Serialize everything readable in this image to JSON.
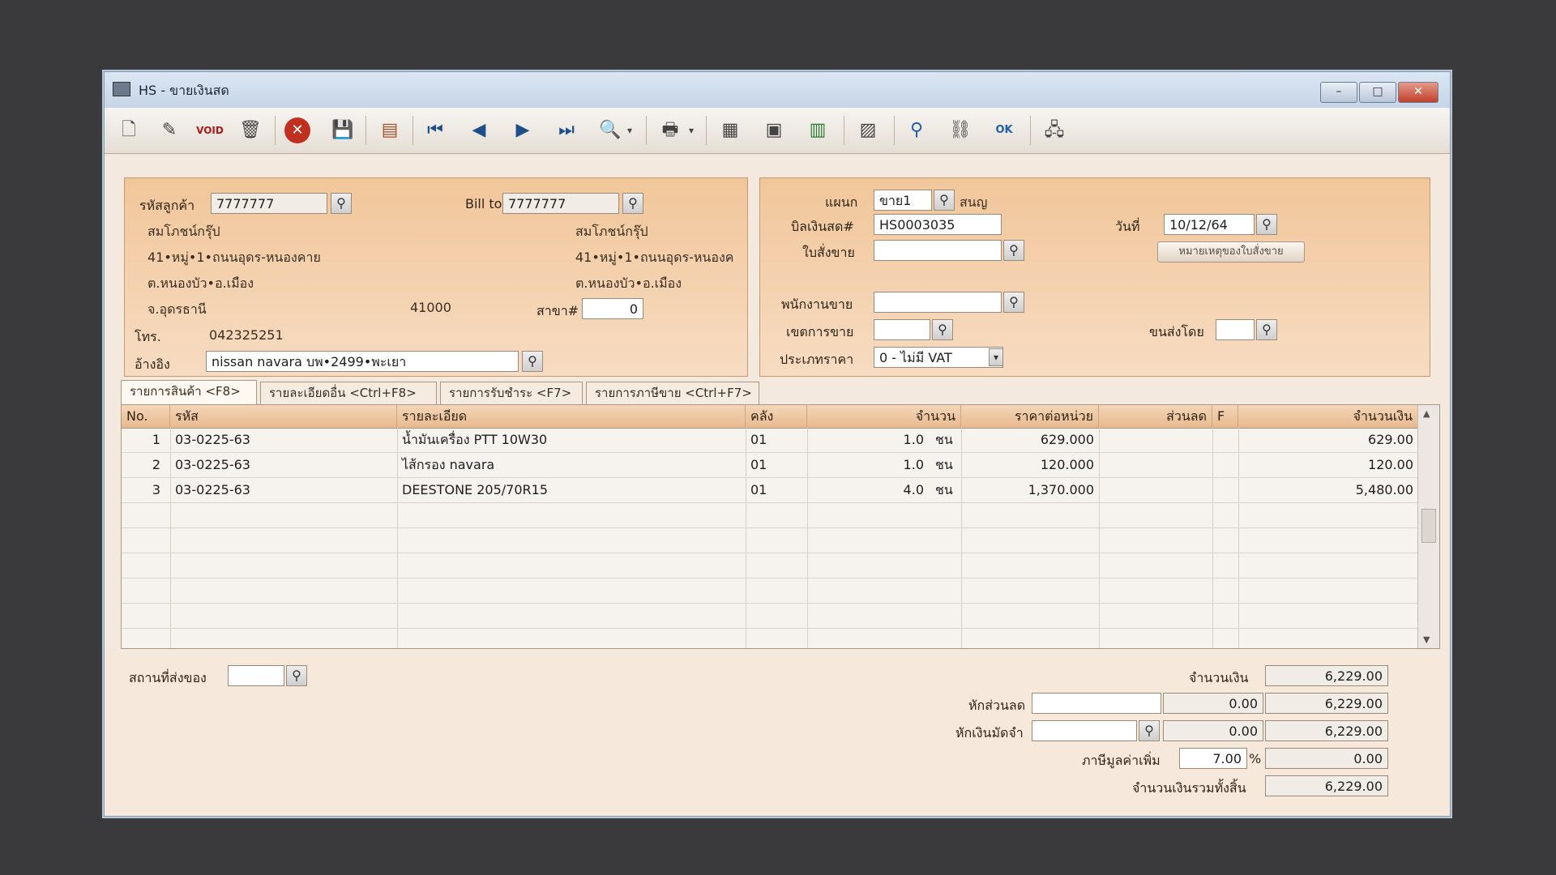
{
  "window": {
    "title": "HS - ขายเงินสด",
    "minimize": "–",
    "maximize": "□",
    "close": "✕"
  },
  "toolbar": {
    "icons": [
      "new-document-icon",
      "edit-icon",
      "void-icon",
      "delete-trash-icon",
      "cancel-icon",
      "save-icon",
      "print-batch-icon",
      "first-record-icon",
      "previous-record-icon",
      "next-record-icon",
      "last-record-icon",
      "search-icon",
      "printer-icon",
      "calculator-icon",
      "register-icon",
      "display-icon",
      "calendar-icon",
      "approve-icon",
      "link-icon",
      "ok-icon",
      "network-icon"
    ]
  },
  "customer": {
    "code_label": "รหัสลูกค้า",
    "code_value": "7777777",
    "name": "สมโภชน์กรุ๊ป",
    "address1": "41•หมู่•1•ถนนอุดร-หนองคาย",
    "address2": "ต.หนองบัว•อ.เมือง",
    "province": "จ.อุดรธานี",
    "postcode": "41000",
    "phone_label": "โทร.",
    "phone": "042325251",
    "ref_label": "อ้างอิง",
    "ref_value": "nissan navara บพ•2499•พะเยา"
  },
  "billto": {
    "label": "Bill to",
    "value": "7777777",
    "name": "สมโภชน์กรุ๊ป",
    "address1": "41•หมู่•1•ถนนอุดร-หนองค",
    "address2": "ต.หนองบัว•อ.เมือง",
    "branch_label": "สาขา#",
    "branch_value": "0"
  },
  "right": {
    "dept_label": "แผนก",
    "dept_value": "ขาย1",
    "dept_name": "สนญ",
    "bill_label": "บิลเงินสด#",
    "bill_value": "HS0003035",
    "date_label": "วันที่",
    "date_value": "10/12/64",
    "order_label": "ใบสั่งขาย",
    "order_value": "",
    "note_button": "หมายเหตุของใบสั่งขาย",
    "salesman_label": "พนักงานขาย",
    "salesman_value": "",
    "zone_label": "เขตการขาย",
    "zone_value": "",
    "ship_label": "ขนส่งโดย",
    "ship_value": "",
    "price_type_label": "ประเภทราคา",
    "price_type_value": "0 - ไม่มี VAT"
  },
  "tabs": [
    {
      "label": "รายการสินค้า <F8>"
    },
    {
      "label": "รายละเอียดอื่น <Ctrl+F8>"
    },
    {
      "label": "รายการรับชำระ <F7>"
    },
    {
      "label": "รายการภาษีขาย <Ctrl+F7>"
    }
  ],
  "grid": {
    "headers": [
      "No.",
      "รหัส",
      "รายละเอียด",
      "คลัง",
      "จำนวน",
      "ราคาต่อหน่วย",
      "ส่วนลด",
      "F",
      "จำนวนเงิน"
    ],
    "rows": [
      {
        "no": "1",
        "code": "03-0225-63",
        "desc": "น้ำมันเครื่อง PTT 10W30",
        "wh": "01",
        "qty": "1.0",
        "unit": "ชน",
        "price": "629.000",
        "disc": "",
        "f": "",
        "amount": "629.00"
      },
      {
        "no": "2",
        "code": "03-0225-63",
        "desc": "ไส้กรอง navara",
        "wh": "01",
        "qty": "1.0",
        "unit": "ชน",
        "price": "120.000",
        "disc": "",
        "f": "",
        "amount": "120.00"
      },
      {
        "no": "3",
        "code": "03-0225-63",
        "desc": "DEESTONE 205/70R15",
        "wh": "01",
        "qty": "4.0",
        "unit": "ชน",
        "price": "1,370.000",
        "disc": "",
        "f": "",
        "amount": "5,480.00"
      }
    ]
  },
  "footer": {
    "delivery_label": "สถานที่ส่งของ",
    "delivery_value": "",
    "amount_label": "จำนวนเงิน",
    "amount_value": "6,229.00",
    "discount_label": "หักส่วนลด",
    "discount_input": "",
    "discount_amount": "0.00",
    "after_discount": "6,229.00",
    "deposit_label": "หักเงินมัดจำ",
    "deposit_input": "",
    "deposit_amount": "0.00",
    "after_deposit": "6,229.00",
    "vat_label": "ภาษีมูลค่าเพิ่ม",
    "vat_rate": "7.00",
    "vat_pct": "%",
    "vat_amount": "0.00",
    "total_label": "จำนวนเงินรวมทั้งสิ้น",
    "total_value": "6,229.00"
  }
}
